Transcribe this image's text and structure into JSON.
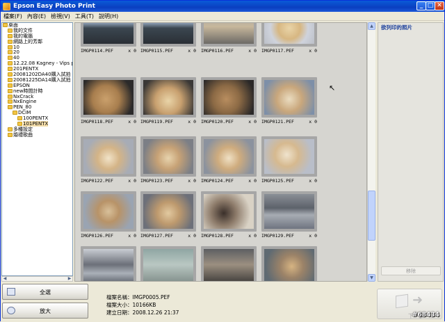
{
  "window": {
    "title": "Epson Easy Photo Print",
    "min": "_",
    "max": "□",
    "close": "✕"
  },
  "menu": [
    "檔案(F)",
    "內容(E)",
    "檢視(V)",
    "工具(T)",
    "說明(H)"
  ],
  "tree": [
    {
      "label": "桌面",
      "indent": 0,
      "selected": false
    },
    {
      "label": "我的文件",
      "indent": 1,
      "selected": false
    },
    {
      "label": "我的電腦",
      "indent": 1,
      "selected": false
    },
    {
      "label": "網路上的芳鄰",
      "indent": 1,
      "selected": false
    },
    {
      "label": "10",
      "indent": 1,
      "selected": false
    },
    {
      "label": "20",
      "indent": 1,
      "selected": false
    },
    {
      "label": "40",
      "indent": 1,
      "selected": false
    },
    {
      "label": "12.22.08 Kagney - Vips party",
      "indent": 1,
      "selected": false
    },
    {
      "label": "201PENTX",
      "indent": 1,
      "selected": false
    },
    {
      "label": "20081202DA40購入試拍",
      "indent": 1,
      "selected": false
    },
    {
      "label": "20081225DA14購入試拍",
      "indent": 1,
      "selected": false
    },
    {
      "label": "EPSON",
      "indent": 1,
      "selected": false
    },
    {
      "label": "new時間計時",
      "indent": 1,
      "selected": false
    },
    {
      "label": "NxCrack",
      "indent": 1,
      "selected": false
    },
    {
      "label": "NxEngine",
      "indent": 1,
      "selected": false
    },
    {
      "label": "PEN_80",
      "indent": 1,
      "selected": false
    },
    {
      "label": "DCIM",
      "indent": 2,
      "selected": false
    },
    {
      "label": "100PENTX",
      "indent": 3,
      "selected": false
    },
    {
      "label": "101PENTX",
      "indent": 3,
      "selected": true
    },
    {
      "label": "多種設定",
      "indent": 1,
      "selected": false
    },
    {
      "label": "婚禮歌曲",
      "indent": 1,
      "selected": false
    }
  ],
  "thumbnails": [
    {
      "name": "IMGP0114.PEF",
      "count": "x 0"
    },
    {
      "name": "IMGP0115.PEF",
      "count": "x 0"
    },
    {
      "name": "IMGP0116.PEF",
      "count": "x 0"
    },
    {
      "name": "IMGP0117.PEF",
      "count": "x 0"
    },
    {
      "name": "IMGP0118.PEF",
      "count": "x 0"
    },
    {
      "name": "IMGP0119.PEF",
      "count": "x 0"
    },
    {
      "name": "IMGP0120.PEF",
      "count": "x 0"
    },
    {
      "name": "IMGP0121.PEF",
      "count": "x 0"
    },
    {
      "name": "IMGP0122.PEF",
      "count": "x 0"
    },
    {
      "name": "IMGP0123.PEF",
      "count": "x 0"
    },
    {
      "name": "IMGP0124.PEF",
      "count": "x 0"
    },
    {
      "name": "IMGP0125.PEF",
      "count": "x 0"
    },
    {
      "name": "IMGP0126.PEF",
      "count": "x 0"
    },
    {
      "name": "IMGP0127.PEF",
      "count": "x 0"
    },
    {
      "name": "IMGP0128.PEF",
      "count": "x 0"
    },
    {
      "name": "IMGP0129.PEF",
      "count": "x 0"
    },
    {
      "name": "",
      "count": ""
    },
    {
      "name": "",
      "count": ""
    },
    {
      "name": "",
      "count": ""
    },
    {
      "name": "",
      "count": ""
    }
  ],
  "print_panel": {
    "title": "欲列印的照片",
    "remove_label": "移除"
  },
  "buttons": {
    "select_all": "全選",
    "zoom": "放大",
    "next": "下一步"
  },
  "file_info": {
    "name_label": "檔案名稱：",
    "name": "IMGP0005.PEF",
    "size_label": "檔案大小：",
    "size": "10166KB",
    "date_label": "建立日期：",
    "date": "2008.12.26 21:37"
  },
  "watermark": "#68434",
  "colors": {
    "titlebar": "#0a3fc0",
    "selection": "#f5deaa"
  }
}
